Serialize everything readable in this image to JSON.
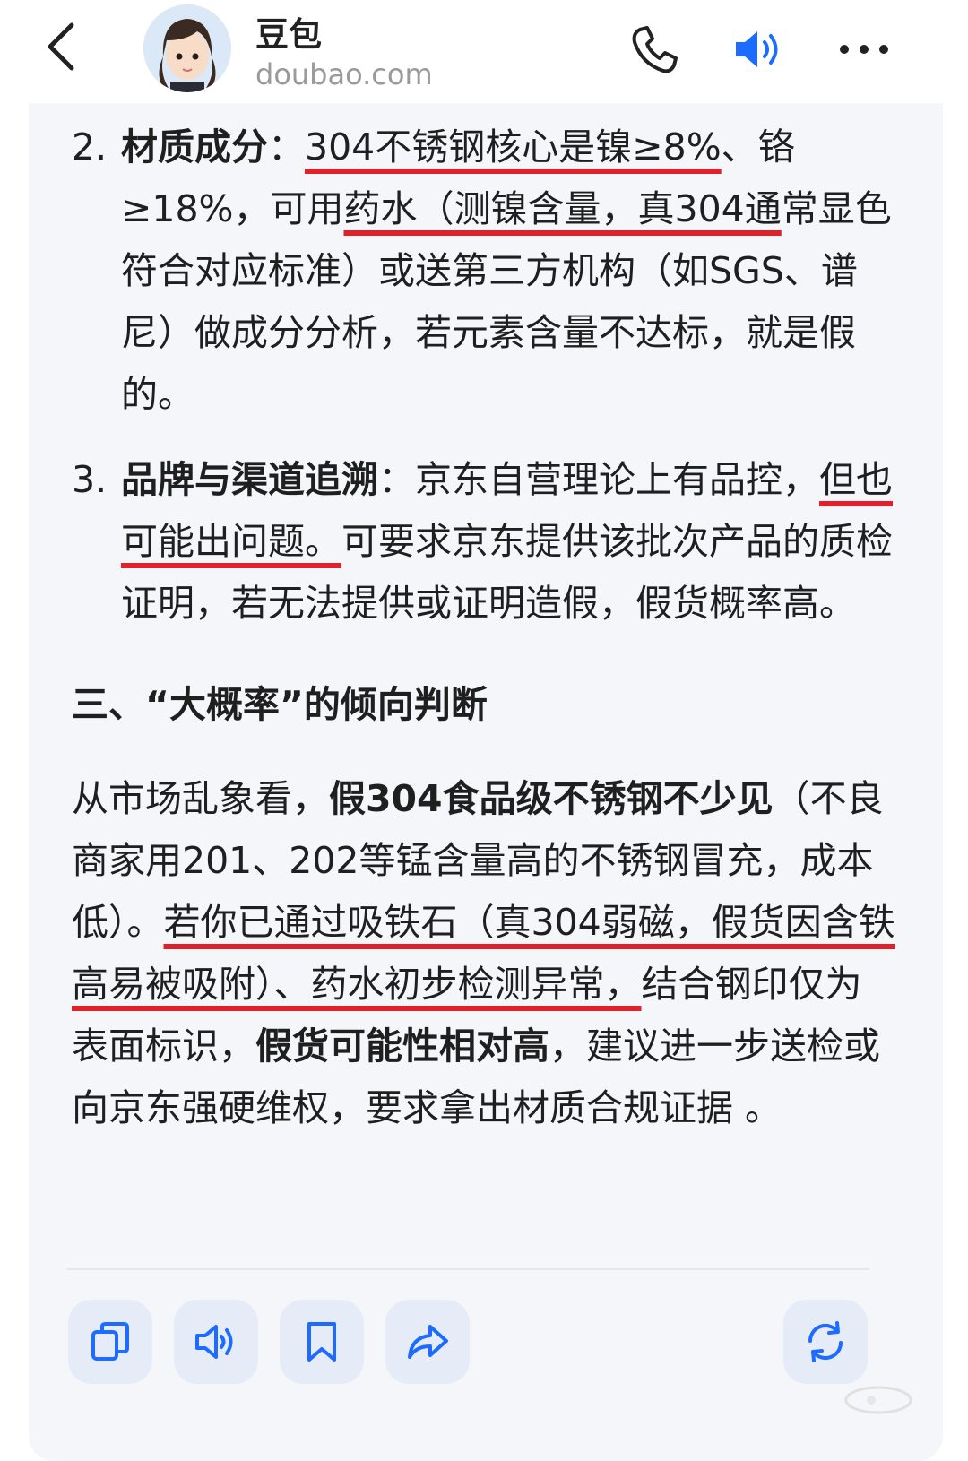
{
  "header": {
    "title": "豆包",
    "subtitle": "doubao.com"
  },
  "content": {
    "item2": {
      "num": "2.",
      "label": "材质成分",
      "colon": "：",
      "u1": "304不锈钢核心是镍≥8%",
      "t1": "、铬≥18%，可用",
      "u2": "药水（测镍含量，真304通",
      "t2": "常显色符合对应标准）或送第三方机构（如SGS、谱尼）做成分分析，若元素含量不达标，就是假的。"
    },
    "item3": {
      "num": "3.",
      "label": "品牌与渠道追溯",
      "colon": "：",
      "t0": "京东自营理论上有品控，",
      "u1": "但也可能出问题。",
      "t1": "可要求京东提供该批次产品的质检证明，若无法提供或证明造假，假货概率高。"
    },
    "heading": "三、“大概率”的倾向判断",
    "para": {
      "t0": "从市场乱象看，",
      "b1": "假304食品级不锈钢不少见",
      "t1": "（不良商家用201、202等锰含量高的不锈钢冒充，成本低）。",
      "u1": "若你已通过吸铁石（真304弱磁，假货因含铁高易被吸附）、药水初步检测异常，",
      "t2": "结合钢印仅为表面标识，",
      "b2": "假货可能性相对高",
      "t3": "，建议进一步送检或向京东强硬维权，要求拿出材质合规证据 。"
    }
  },
  "colors": {
    "accent": "#1e6bff",
    "underline": "#e0202a",
    "card_bg": "#f5f6fa",
    "button_bg": "#e6ecf7"
  },
  "icons": [
    "back-arrow-icon",
    "phone-icon",
    "speaker-icon",
    "more-icon",
    "copy-icon",
    "read-aloud-icon",
    "bookmark-icon",
    "share-icon",
    "regenerate-icon"
  ]
}
